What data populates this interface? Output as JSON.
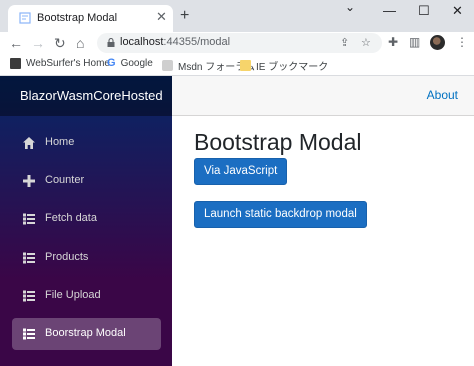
{
  "browser": {
    "tab_title": "Bootstrap Modal",
    "new_tab_symbol": "+",
    "url_host": "localhost",
    "url_rest": ":44355/modal",
    "bookmarks": [
      "WebSurfer's Home",
      "Google",
      "Msdn フォーラム",
      "IE ブックマーク"
    ]
  },
  "sidebar": {
    "brand": "BlazorWasmCoreHosted",
    "items": [
      {
        "label": "Home",
        "icon": "home-icon"
      },
      {
        "label": "Counter",
        "icon": "plus-icon"
      },
      {
        "label": "Fetch data",
        "icon": "list-icon"
      },
      {
        "label": "Products",
        "icon": "list-icon"
      },
      {
        "label": "File Upload",
        "icon": "list-icon"
      },
      {
        "label": "Boorstrap Modal",
        "icon": "list-icon",
        "active": true
      }
    ]
  },
  "topbar": {
    "about": "About"
  },
  "main": {
    "heading": "Bootstrap Modal",
    "btn_js": "Via JavaScript",
    "btn_static": "Launch static backdrop modal"
  },
  "colors": {
    "primary": "#1b6ec2",
    "link": "#0071c1",
    "sidebar_top": "#052767",
    "sidebar_bottom": "#3a0647"
  }
}
